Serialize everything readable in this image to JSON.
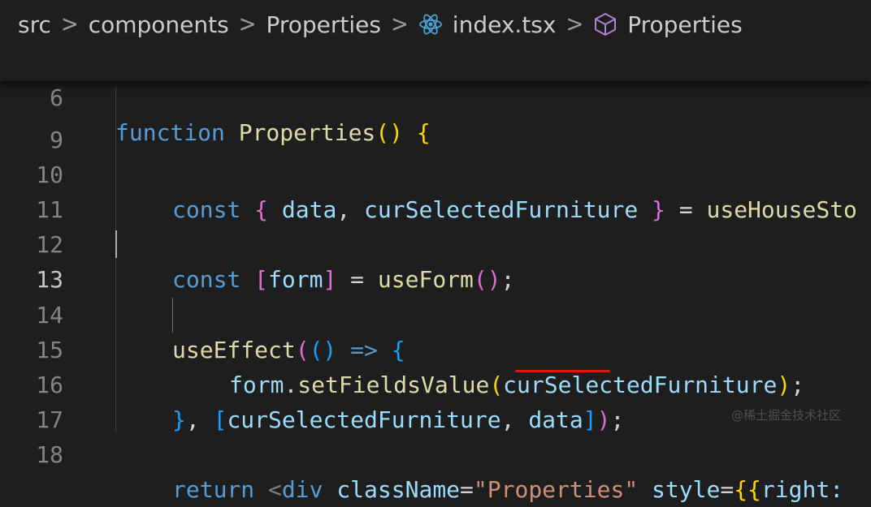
{
  "breadcrumb": {
    "segments": [
      "src",
      "components",
      "Properties",
      "index.tsx",
      "Properties"
    ],
    "separator": ">",
    "icons": [
      "react-icon",
      "cube-icon"
    ]
  },
  "sticky": {
    "line_number": "6",
    "code": [
      "function",
      "Properties",
      "()",
      "{"
    ]
  },
  "lines": [
    {
      "number": "9"
    },
    {
      "number": "10",
      "code": [
        "const",
        "{",
        "data",
        ",",
        "curSelectedFurniture",
        "}",
        "=",
        "useHouseSto"
      ]
    },
    {
      "number": "11"
    },
    {
      "number": "12",
      "code": [
        "const",
        "[",
        "form",
        "]",
        "=",
        "useForm",
        "(",
        ")",
        ";"
      ]
    },
    {
      "number": "13"
    },
    {
      "number": "14",
      "code": [
        "useEffect",
        "(",
        "()",
        "=>",
        "{"
      ]
    },
    {
      "number": "15",
      "code": [
        "form",
        ".",
        "setFieldsValue",
        "(",
        "curSelectedFurniture",
        ")",
        ";"
      ]
    },
    {
      "number": "16",
      "code": [
        "}",
        ",",
        "[",
        "curSelectedFurniture",
        ",",
        "data",
        "]",
        ")",
        ";"
      ]
    },
    {
      "number": "17"
    },
    {
      "number": "18",
      "code": [
        "return",
        "<",
        "div",
        "className",
        "=",
        "\"Properties\"",
        "style",
        "=",
        "{{",
        "right:"
      ]
    }
  ],
  "watermark": "@稀土掘金技术社区",
  "colors": {
    "background": "#1e1e1e",
    "keyword": "#569cd6",
    "function": "#dcdcaa",
    "variable": "#9cdcfe",
    "bracket_gold": "#ffd700",
    "bracket_purple": "#da70d6",
    "bracket_blue": "#179fff",
    "string": "#ce9178",
    "underline": "#e51400"
  }
}
